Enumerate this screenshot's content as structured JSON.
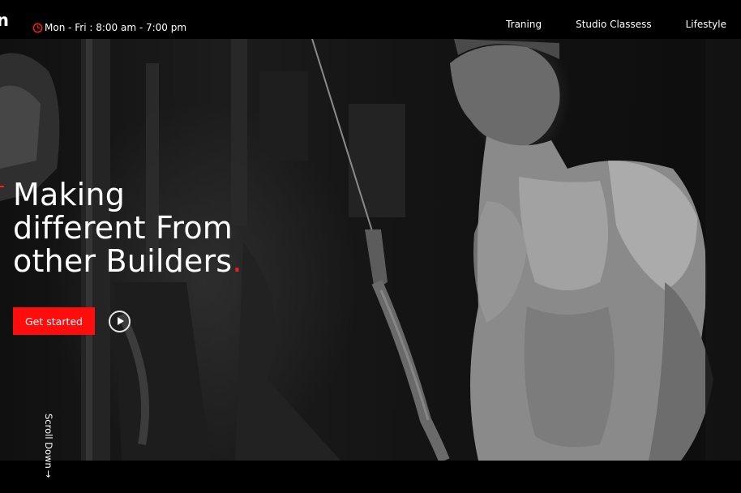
{
  "header": {
    "logo_fragment": "n",
    "hours_icon": "clock-icon",
    "hours_text": "Mon - Fri : 8:00 am - 7:00 pm",
    "nav": [
      {
        "label": "Traning"
      },
      {
        "label": "Studio Classess"
      },
      {
        "label": "Lifestyle"
      }
    ]
  },
  "hero": {
    "headline_lines": [
      "Making",
      "different From",
      "other Builders"
    ],
    "headline_dot": ".",
    "cta_label": "Get started",
    "play_icon": "play-icon",
    "scroll_label": "Scroll Down",
    "scroll_arrow": "→"
  },
  "colors": {
    "accent": "#ff0d0d",
    "background": "#000000",
    "text": "#ffffff"
  }
}
